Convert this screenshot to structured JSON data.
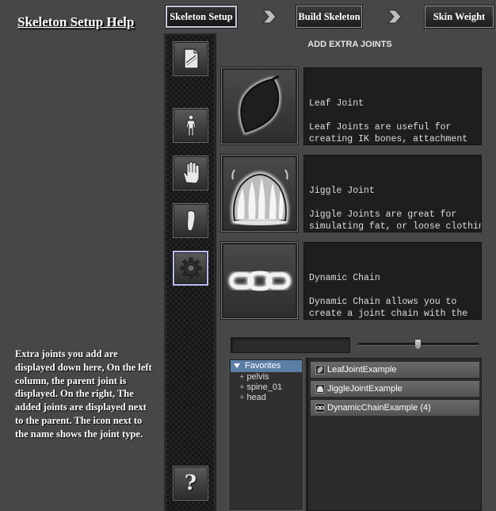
{
  "help": {
    "title": "Skeleton Setup Help",
    "text": "Extra joints you add are displayed down here, On the left column, the parent joint is displayed. On the right, The added joints are displayed next to the parent. The icon next to the name shows the joint type."
  },
  "steps": [
    {
      "label": "Skeleton Setup",
      "active": true
    },
    {
      "label": "Build Skeleton",
      "active": false
    },
    {
      "label": "Skin Weight",
      "active": false
    }
  ],
  "sidebar": {
    "items": [
      {
        "icon": "template-icon"
      },
      {
        "icon": "body-icon"
      },
      {
        "icon": "hand-icon"
      },
      {
        "icon": "foot-icon"
      },
      {
        "icon": "gear-icon",
        "selected": true
      },
      {
        "icon": "help-icon",
        "glyph": "?"
      }
    ]
  },
  "main": {
    "header": "ADD EXTRA JOINTS",
    "joints": [
      {
        "title": "Leaf Joint",
        "description": "Leaf Joints are useful for\ncreating IK bones, attachment\nbones, etc.",
        "icon": "leaf-icon"
      },
      {
        "title": "Jiggle Joint",
        "description": "Jiggle Joints are great for\nsimulating fat, or loose clothing\nitems, etc.",
        "icon": "jelly-icon"
      },
      {
        "title": "Dynamic Chain",
        "description": "Dynamic Chain allows you to\ncreate a joint chain with the\nnumber of joints specified,\nthat, when rigged, will be\nsimulated.",
        "icon": "chain-icon"
      }
    ],
    "filter": {
      "value": ""
    },
    "slider": {
      "value": 0.5
    }
  },
  "tree": {
    "header": "Favorites",
    "items": [
      "pelvis",
      "spine_01",
      "head"
    ]
  },
  "list": {
    "items": [
      {
        "label": "LeafJointExample",
        "icon": "leaf-icon"
      },
      {
        "label": "JiggleJointExample",
        "icon": "jelly-icon"
      },
      {
        "label": "DynamicChainExample (4)",
        "icon": "chain-icon"
      }
    ]
  },
  "colors": {
    "background": "#474747",
    "tree_selection": "#5b7fa6",
    "selected_border": "#b9bdf0"
  }
}
